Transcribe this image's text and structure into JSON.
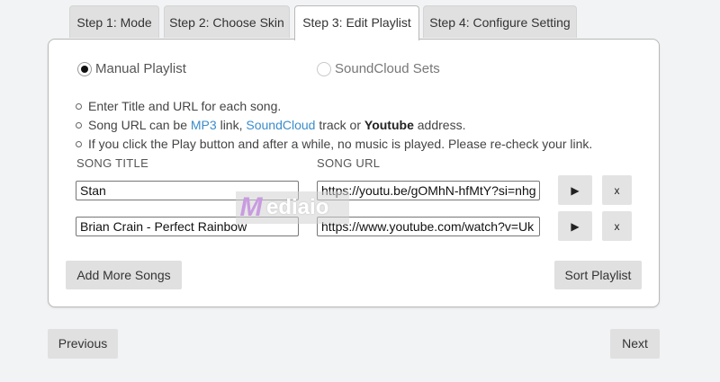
{
  "tabs": [
    {
      "label": "Step 1: Mode"
    },
    {
      "label": "Step 2: Choose Skin"
    },
    {
      "label": "Step 3: Edit Playlist"
    },
    {
      "label": "Step 4: Configure Setting"
    }
  ],
  "active_tab": "Step 3: Edit Playlist",
  "playlist_type": {
    "manual_label": "Manual Playlist",
    "soundcloud_label": "SoundCloud Sets",
    "selected": "Manual Playlist"
  },
  "notes": {
    "line1": "Enter Title and URL for each song.",
    "line2_a": "Song URL can be ",
    "line2_mp3": "MP3",
    "line2_b": " link, ",
    "line2_soundcloud": "SoundCloud",
    "line2_c": " track or ",
    "line2_youtube": "Youtube",
    "line2_d": " address.",
    "line3": "If you click the Play button and after a while, no music is played. Please re-check your link."
  },
  "columns": {
    "title": "SONG TITLE",
    "url": "SONG URL"
  },
  "songs": [
    {
      "title": "Stan",
      "url": "https://youtu.be/gOMhN-hfMtY?si=nhg"
    },
    {
      "title": "Brian Crain - Perfect Rainbow",
      "url": "https://www.youtube.com/watch?v=Uk"
    }
  ],
  "icons": {
    "play": "▶",
    "remove": "x"
  },
  "buttons": {
    "add_more": "Add More Songs",
    "sort": "Sort Playlist",
    "previous": "Previous",
    "next": "Next"
  },
  "watermark": {
    "letter": "M",
    "text": "ediaio"
  },
  "colors": {
    "link": "#3b8ccb",
    "background": "#f1f3f4",
    "button": "#e0e0e0"
  }
}
